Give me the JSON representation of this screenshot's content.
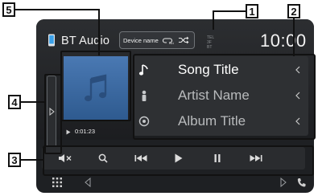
{
  "header": {
    "title": "BT Audio",
    "device_name_chip": "Device name",
    "clock": "10:00",
    "tel_info": [
      "TEL",
      "3F",
      "BT"
    ]
  },
  "artwork": {
    "play_time": "0:01:23"
  },
  "song_info": {
    "title": "Song Title",
    "artist": "Artist Name",
    "album": "Album Title",
    "title_color": "#ffffff",
    "secondary_color": "#b8babc"
  },
  "controls": [
    {
      "name": "mute-button",
      "icon": "mute-icon"
    },
    {
      "name": "search-button",
      "icon": "search-icon"
    },
    {
      "name": "previous-track-button",
      "icon": "previous-icon"
    },
    {
      "name": "play-button",
      "icon": "play-icon"
    },
    {
      "name": "pause-button",
      "icon": "pause-icon"
    },
    {
      "name": "next-track-button",
      "icon": "next-icon"
    }
  ],
  "callouts": {
    "c1": "1",
    "c2": "2",
    "c3": "3",
    "c4": "4",
    "c5": "5"
  },
  "colors": {
    "screen_bg": "#1e2023",
    "artwork_bg": "#4a79b3",
    "text": "#f2f2f2",
    "phone_icon_accent": "#3aa0e8"
  }
}
